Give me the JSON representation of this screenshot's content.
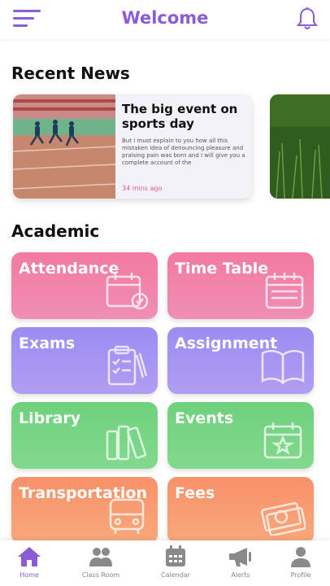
{
  "header": {
    "title": "Welcome"
  },
  "recent_news": {
    "section_title": "Recent News",
    "items": [
      {
        "headline": "The big event on sports day",
        "excerpt": "But I must explain to you how all this mistaken idea of denouncing pleasure and praising pain was born and I will give you a complete account of the",
        "time": "34 mins ago"
      }
    ]
  },
  "academic": {
    "section_title": "Academic",
    "tiles": [
      {
        "label": "Attendance",
        "color": "#f27aa0",
        "icon": "calendar-check-icon"
      },
      {
        "label": "Time Table",
        "color": "#f27aa0",
        "icon": "calendar-icon"
      },
      {
        "label": "Exams",
        "color": "#9c8cf2",
        "icon": "clipboard-icon"
      },
      {
        "label": "Assignment",
        "color": "#9c8cf2",
        "icon": "book-icon"
      },
      {
        "label": "Library",
        "color": "#6fd17c",
        "icon": "books-icon"
      },
      {
        "label": "Events",
        "color": "#6fd17c",
        "icon": "calendar-star-icon"
      },
      {
        "label": "Transportation",
        "color": "#f7916a",
        "icon": "bus-icon"
      },
      {
        "label": "Fees",
        "color": "#f7916a",
        "icon": "money-icon"
      }
    ]
  },
  "bottom_nav": {
    "active": "Home",
    "items": [
      {
        "label": "Home",
        "icon": "home-icon"
      },
      {
        "label": "Class Room",
        "icon": "users-icon"
      },
      {
        "label": "Calendar",
        "icon": "calendar-icon"
      },
      {
        "label": "Alerts",
        "icon": "megaphone-icon"
      },
      {
        "label": "Profile",
        "icon": "profile-icon"
      }
    ]
  },
  "colors": {
    "accent": "#8a5cd6",
    "time": "#e05a90",
    "inactive": "#888888"
  }
}
